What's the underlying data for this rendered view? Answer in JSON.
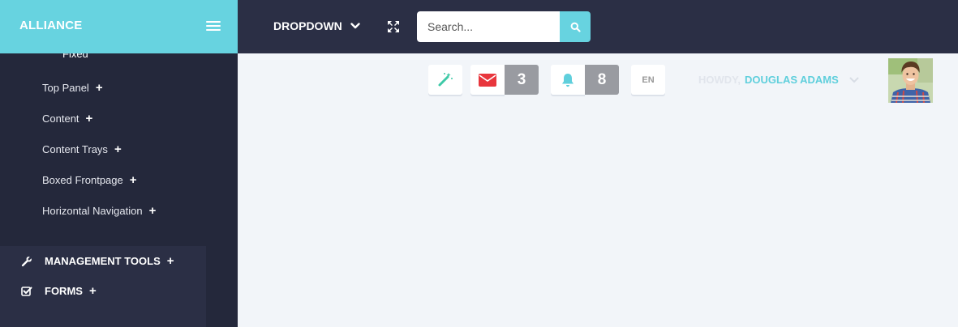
{
  "brand": {
    "name": "ALLIANCE"
  },
  "topbar": {
    "dropdown_label": "DROPDOWN",
    "search_placeholder": "Search..."
  },
  "sidebar": {
    "fixed_label": "Fixed",
    "sub_items": [
      {
        "label": "Top Panel"
      },
      {
        "label": "Content"
      },
      {
        "label": "Content Trays"
      },
      {
        "label": "Boxed Frontpage"
      },
      {
        "label": "Horizontal Navigation"
      }
    ],
    "main_items": [
      {
        "label": "MANAGEMENT TOOLS",
        "icon": "wrench-icon"
      },
      {
        "label": "FORMS",
        "icon": "checkbox-icon"
      }
    ],
    "plus_symbol": "+"
  },
  "toolbar": {
    "messages_count": "3",
    "notifications_count": "8",
    "language": "EN",
    "greeting": "HOWDY,",
    "user_name": "DOUGLAS ADAMS"
  },
  "colors": {
    "brand": "#67d3e0",
    "navbar": "#2b2f45",
    "sidebar": "#24283b",
    "mail_icon": "#e8363d",
    "bell_icon": "#5fcfdc",
    "wand_icon": "#3ec9a7"
  }
}
